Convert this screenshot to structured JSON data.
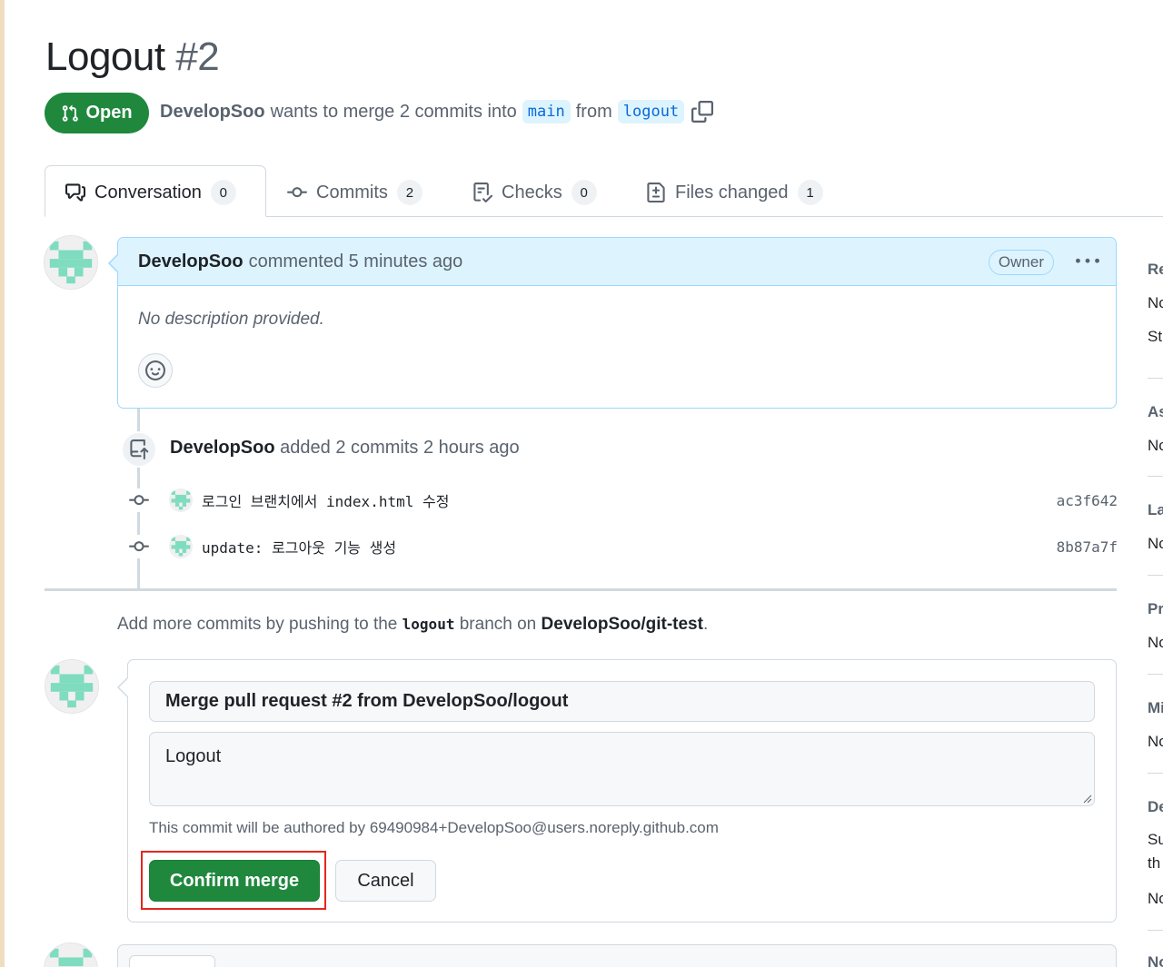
{
  "pr": {
    "title": "Logout",
    "number": "#2",
    "state": "Open",
    "author": "DevelopSoo",
    "merge_text": "wants to merge 2 commits into",
    "base_branch": "main",
    "from_text": "from",
    "head_branch": "logout"
  },
  "tabs": [
    {
      "label": "Conversation",
      "count": "0"
    },
    {
      "label": "Commits",
      "count": "2"
    },
    {
      "label": "Checks",
      "count": "0"
    },
    {
      "label": "Files changed",
      "count": "1"
    }
  ],
  "comment": {
    "author": "DevelopSoo",
    "action": "commented 5 minutes ago",
    "role_badge": "Owner",
    "body": "No description provided."
  },
  "timeline": {
    "event_author": "DevelopSoo",
    "event_text": "added 2 commits 2 hours ago",
    "commits": [
      {
        "message": "로그인 브랜치에서 index.html 수정",
        "sha": "ac3f642"
      },
      {
        "message": "update: 로그아웃 기능 생성",
        "sha": "8b87a7f"
      }
    ]
  },
  "push_hint": {
    "prefix": "Add more commits by pushing to the",
    "branch": "logout",
    "middle": "branch on",
    "repo": "DevelopSoo/git-test",
    "suffix": "."
  },
  "merge": {
    "commit_title": "Merge pull request #2 from DevelopSoo/logout",
    "commit_body": "Logout",
    "author_note": "This commit will be authored by 69490984+DevelopSoo@users.noreply.github.com",
    "confirm_label": "Confirm merge",
    "cancel_label": "Cancel"
  },
  "sidebar": {
    "reviewers_h": "Re",
    "reviewers_t1": "No",
    "reviewers_t2": "St",
    "assignees_h": "As",
    "assignees_t": "No",
    "labels_h": "La",
    "labels_t": "No",
    "projects_h": "Pr",
    "projects_t": "No",
    "milestone_h": "Mi",
    "milestone_t": "No",
    "development_h": "De",
    "development_t1": "Su",
    "development_t2": "th",
    "development_t3": "No",
    "notifications_h": "No"
  },
  "colors": {
    "open_green": "#1f883d",
    "branch_bg": "#ddf4ff",
    "branch_fg": "#0969da",
    "highlight_red": "#e5261c"
  },
  "icons": {
    "state": "git-pull-request-icon",
    "copy": "copy-icon",
    "conversation": "comment-discussion-icon",
    "commits": "git-commit-icon",
    "checks": "checklist-icon",
    "files": "file-diff-icon",
    "kebab": "kebab-horizontal-icon",
    "emoji": "smiley-icon",
    "push": "repo-push-icon"
  }
}
